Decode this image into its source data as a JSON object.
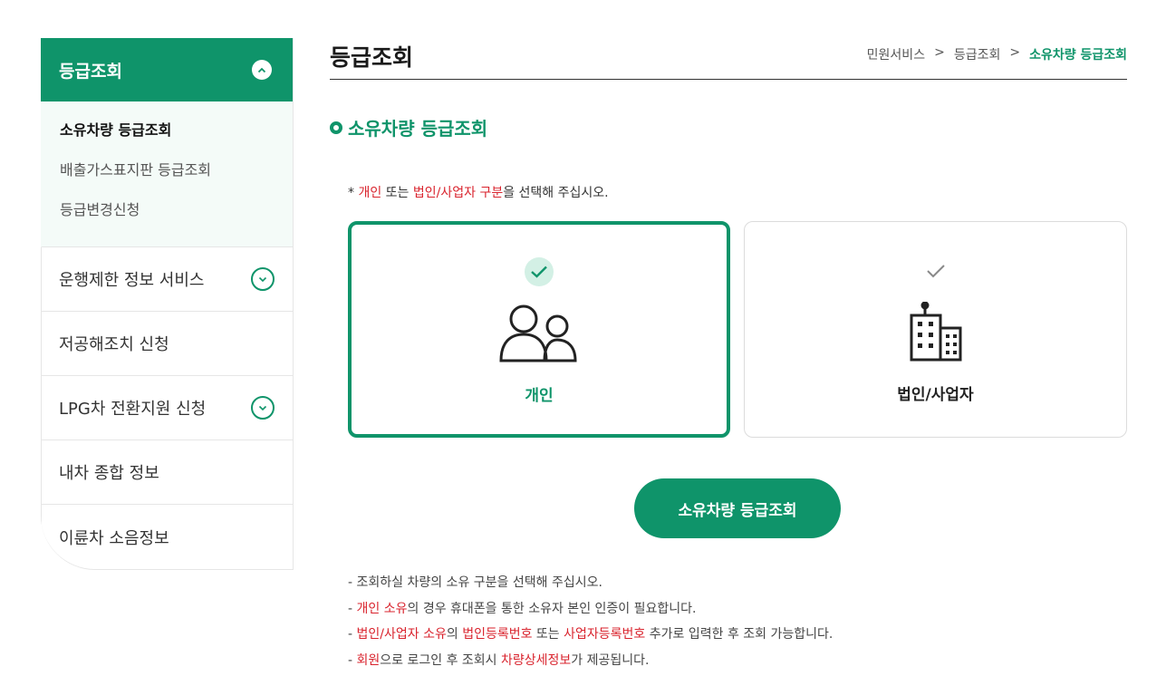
{
  "sidebar": {
    "header": "등급조회",
    "sub_items": [
      {
        "label": "소유차량 등급조회"
      },
      {
        "label": "배출가스표지판 등급조회"
      },
      {
        "label": "등급변경신청"
      }
    ],
    "items": [
      {
        "label": "운행제한 정보 서비스"
      },
      {
        "label": "저공해조치 신청"
      },
      {
        "label": "LPG차 전환지원 신청"
      },
      {
        "label": "내차 종합 정보"
      },
      {
        "label": "이륜차 소음정보"
      }
    ]
  },
  "header": {
    "title": "등급조회",
    "breadcrumb": [
      "민원서비스",
      ">",
      "등급조회",
      ">",
      "소유차량 등급조회"
    ]
  },
  "section": {
    "title": "소유차량 등급조회"
  },
  "notice": {
    "prefix": "* ",
    "part1": "개인",
    "part2": " 또는 ",
    "part3": "법인/사업자 구분",
    "part4": "을 선택해 주십시오."
  },
  "cards": {
    "personal": {
      "label": "개인",
      "icon": "people-icon",
      "selected": true
    },
    "corporate": {
      "label": "법인/사업자",
      "icon": "building-icon",
      "selected": false
    }
  },
  "query_button": "소유차량 등급조회",
  "notes": [
    [
      {
        "t": "- 조회하실 차량의 소유 구분을 선택해 주십시오."
      }
    ],
    [
      {
        "t": "- "
      },
      {
        "t": "개인 소유",
        "red": true
      },
      {
        "t": "의 경우 휴대폰을 통한 소유자 본인 인증이 필요합니다."
      }
    ],
    [
      {
        "t": "- "
      },
      {
        "t": "법인/사업자 소유",
        "red": true
      },
      {
        "t": "의 "
      },
      {
        "t": "법인등록번호",
        "red": true
      },
      {
        "t": " 또는 "
      },
      {
        "t": "사업자등록번호",
        "red": true
      },
      {
        "t": " 추가로 입력한 후 조회 가능합니다."
      }
    ],
    [
      {
        "t": "- "
      },
      {
        "t": "회원",
        "red": true
      },
      {
        "t": "으로 로그인 후 조회시 "
      },
      {
        "t": "차량상세정보",
        "red": true
      },
      {
        "t": "가 제공됩니다."
      }
    ]
  ],
  "colors": {
    "accent": "#0f946a",
    "highlight": "#d9232d"
  }
}
